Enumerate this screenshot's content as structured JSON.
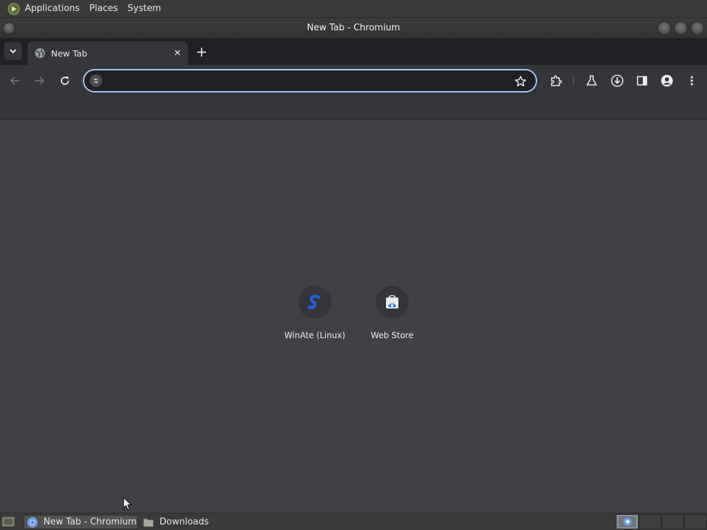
{
  "top_panel": {
    "menus": [
      "Applications",
      "Places",
      "System"
    ]
  },
  "window": {
    "title": "New Tab - Chromium"
  },
  "tabs": [
    {
      "title": "New Tab",
      "close_symbol": "✕"
    }
  ],
  "new_tab_symbol": "+",
  "omnibox": {
    "value": "",
    "placeholder": ""
  },
  "shortcuts": [
    {
      "label": "WinAte (Linux)",
      "icon": "winate-icon"
    },
    {
      "label": "Web Store",
      "icon": "web-store-icon"
    }
  ],
  "taskbar": {
    "tasks": [
      {
        "label": "New Tab - Chromium",
        "icon": "chromium-icon",
        "active": true
      },
      {
        "label": "Downloads",
        "icon": "folder-icon",
        "active": false
      }
    ]
  },
  "colors": {
    "accent": "#a8c7fa",
    "tabstrip": "#202124",
    "toolbar": "#35363a",
    "content": "#414145"
  }
}
